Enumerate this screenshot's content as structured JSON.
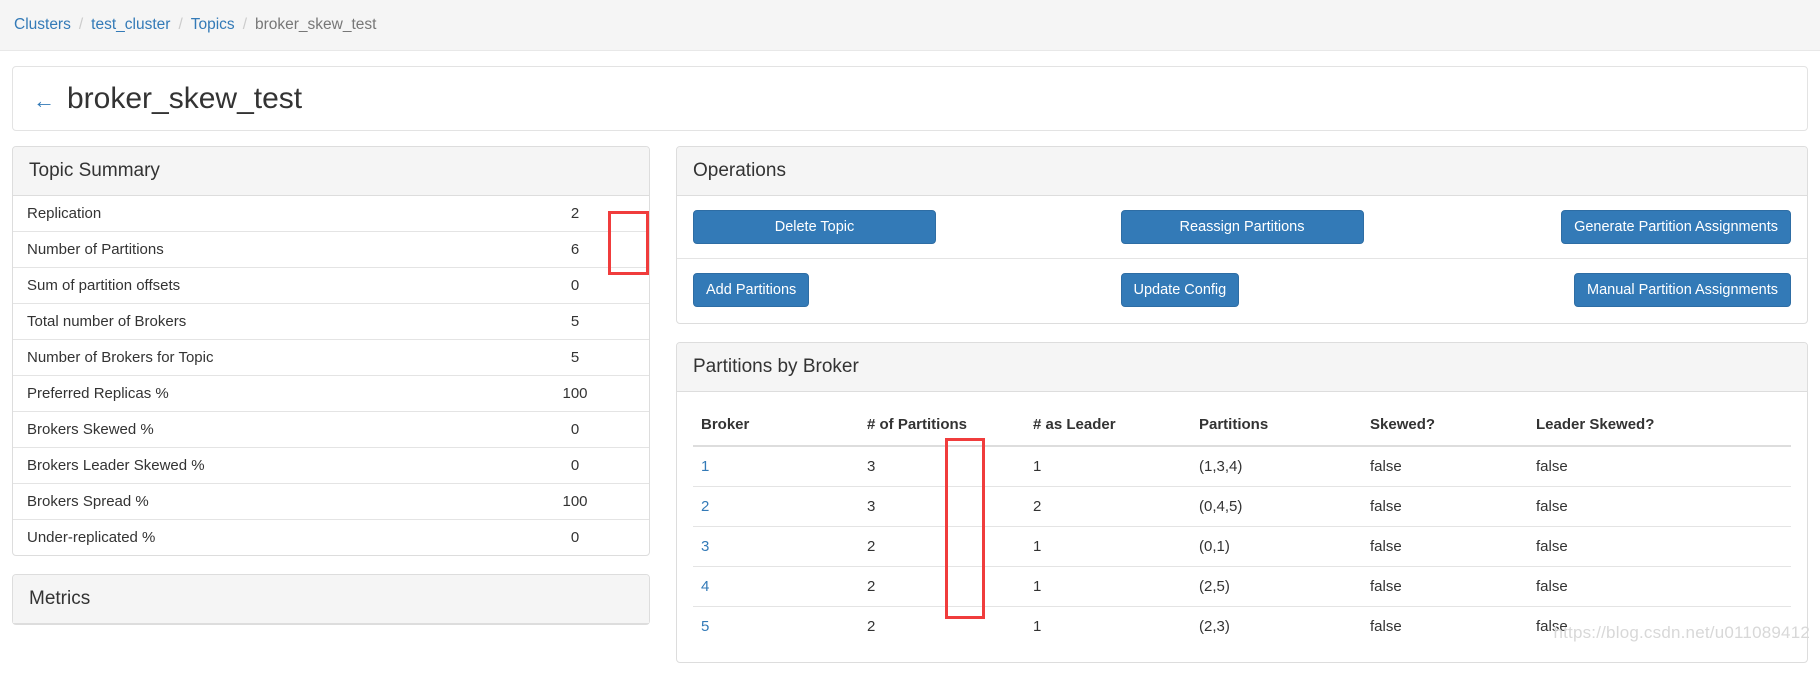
{
  "breadcrumb": {
    "separator": "/",
    "items": [
      {
        "label": "Clusters",
        "active": false
      },
      {
        "label": "test_cluster",
        "active": false
      },
      {
        "label": "Topics",
        "active": false
      },
      {
        "label": "broker_skew_test",
        "active": true
      }
    ]
  },
  "header": {
    "back_arrow": "←",
    "title": "broker_skew_test"
  },
  "topic_summary": {
    "title": "Topic Summary",
    "rows": [
      {
        "label": "Replication",
        "value": "2"
      },
      {
        "label": "Number of Partitions",
        "value": "6"
      },
      {
        "label": "Sum of partition offsets",
        "value": "0"
      },
      {
        "label": "Total number of Brokers",
        "value": "5"
      },
      {
        "label": "Number of Brokers for Topic",
        "value": "5"
      },
      {
        "label": "Preferred Replicas %",
        "value": "100"
      },
      {
        "label": "Brokers Skewed %",
        "value": "0"
      },
      {
        "label": "Brokers Leader Skewed %",
        "value": "0"
      },
      {
        "label": "Brokers Spread %",
        "value": "100"
      },
      {
        "label": "Under-replicated %",
        "value": "0"
      }
    ]
  },
  "metrics": {
    "title": "Metrics"
  },
  "operations": {
    "title": "Operations",
    "row1": [
      {
        "label": "Delete Topic"
      },
      {
        "label": "Reassign Partitions"
      },
      {
        "label": "Generate Partition Assignments"
      }
    ],
    "row2": [
      {
        "label": "Add Partitions"
      },
      {
        "label": "Update Config"
      },
      {
        "label": "Manual Partition Assignments"
      }
    ]
  },
  "partitions_by_broker": {
    "title": "Partitions by Broker",
    "columns": [
      "Broker",
      "# of Partitions",
      "# as Leader",
      "Partitions",
      "Skewed?",
      "Leader Skewed?"
    ],
    "rows": [
      {
        "broker": "1",
        "num_partitions": "3",
        "as_leader": "1",
        "partitions": "(1,3,4)",
        "skewed": "false",
        "leader_skewed": "false"
      },
      {
        "broker": "2",
        "num_partitions": "3",
        "as_leader": "2",
        "partitions": "(0,4,5)",
        "skewed": "false",
        "leader_skewed": "false"
      },
      {
        "broker": "3",
        "num_partitions": "2",
        "as_leader": "1",
        "partitions": "(0,1)",
        "skewed": "false",
        "leader_skewed": "false"
      },
      {
        "broker": "4",
        "num_partitions": "2",
        "as_leader": "1",
        "partitions": "(2,5)",
        "skewed": "false",
        "leader_skewed": "false"
      },
      {
        "broker": "5",
        "num_partitions": "2",
        "as_leader": "1",
        "partitions": "(2,3)",
        "skewed": "false",
        "leader_skewed": "false"
      }
    ]
  },
  "annotations": {
    "highlight_color": "#f03c3c",
    "boxes": [
      {
        "name": "summary-values-highlight"
      },
      {
        "name": "num-partitions-column-highlight"
      }
    ]
  },
  "watermark": {
    "text": "https://blog.csdn.net/u011089412"
  },
  "colors": {
    "link": "#337ab7",
    "button": "#337ab7",
    "panel_header_bg": "#f5f5f5",
    "highlight": "#f03c3c"
  }
}
